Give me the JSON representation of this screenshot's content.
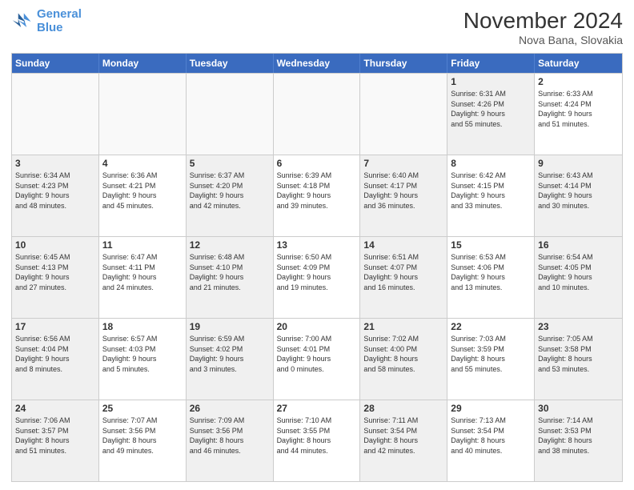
{
  "logo": {
    "line1": "General",
    "line2": "Blue"
  },
  "title": "November 2024",
  "location": "Nova Bana, Slovakia",
  "headers": [
    "Sunday",
    "Monday",
    "Tuesday",
    "Wednesday",
    "Thursday",
    "Friday",
    "Saturday"
  ],
  "weeks": [
    [
      {
        "day": "",
        "info": "",
        "shaded": false,
        "empty": true
      },
      {
        "day": "",
        "info": "",
        "shaded": false,
        "empty": true
      },
      {
        "day": "",
        "info": "",
        "shaded": false,
        "empty": true
      },
      {
        "day": "",
        "info": "",
        "shaded": false,
        "empty": true
      },
      {
        "day": "",
        "info": "",
        "shaded": false,
        "empty": true
      },
      {
        "day": "1",
        "info": "Sunrise: 6:31 AM\nSunset: 4:26 PM\nDaylight: 9 hours\nand 55 minutes.",
        "shaded": true,
        "empty": false
      },
      {
        "day": "2",
        "info": "Sunrise: 6:33 AM\nSunset: 4:24 PM\nDaylight: 9 hours\nand 51 minutes.",
        "shaded": false,
        "empty": false
      }
    ],
    [
      {
        "day": "3",
        "info": "Sunrise: 6:34 AM\nSunset: 4:23 PM\nDaylight: 9 hours\nand 48 minutes.",
        "shaded": true,
        "empty": false
      },
      {
        "day": "4",
        "info": "Sunrise: 6:36 AM\nSunset: 4:21 PM\nDaylight: 9 hours\nand 45 minutes.",
        "shaded": false,
        "empty": false
      },
      {
        "day": "5",
        "info": "Sunrise: 6:37 AM\nSunset: 4:20 PM\nDaylight: 9 hours\nand 42 minutes.",
        "shaded": true,
        "empty": false
      },
      {
        "day": "6",
        "info": "Sunrise: 6:39 AM\nSunset: 4:18 PM\nDaylight: 9 hours\nand 39 minutes.",
        "shaded": false,
        "empty": false
      },
      {
        "day": "7",
        "info": "Sunrise: 6:40 AM\nSunset: 4:17 PM\nDaylight: 9 hours\nand 36 minutes.",
        "shaded": true,
        "empty": false
      },
      {
        "day": "8",
        "info": "Sunrise: 6:42 AM\nSunset: 4:15 PM\nDaylight: 9 hours\nand 33 minutes.",
        "shaded": false,
        "empty": false
      },
      {
        "day": "9",
        "info": "Sunrise: 6:43 AM\nSunset: 4:14 PM\nDaylight: 9 hours\nand 30 minutes.",
        "shaded": true,
        "empty": false
      }
    ],
    [
      {
        "day": "10",
        "info": "Sunrise: 6:45 AM\nSunset: 4:13 PM\nDaylight: 9 hours\nand 27 minutes.",
        "shaded": true,
        "empty": false
      },
      {
        "day": "11",
        "info": "Sunrise: 6:47 AM\nSunset: 4:11 PM\nDaylight: 9 hours\nand 24 minutes.",
        "shaded": false,
        "empty": false
      },
      {
        "day": "12",
        "info": "Sunrise: 6:48 AM\nSunset: 4:10 PM\nDaylight: 9 hours\nand 21 minutes.",
        "shaded": true,
        "empty": false
      },
      {
        "day": "13",
        "info": "Sunrise: 6:50 AM\nSunset: 4:09 PM\nDaylight: 9 hours\nand 19 minutes.",
        "shaded": false,
        "empty": false
      },
      {
        "day": "14",
        "info": "Sunrise: 6:51 AM\nSunset: 4:07 PM\nDaylight: 9 hours\nand 16 minutes.",
        "shaded": true,
        "empty": false
      },
      {
        "day": "15",
        "info": "Sunrise: 6:53 AM\nSunset: 4:06 PM\nDaylight: 9 hours\nand 13 minutes.",
        "shaded": false,
        "empty": false
      },
      {
        "day": "16",
        "info": "Sunrise: 6:54 AM\nSunset: 4:05 PM\nDaylight: 9 hours\nand 10 minutes.",
        "shaded": true,
        "empty": false
      }
    ],
    [
      {
        "day": "17",
        "info": "Sunrise: 6:56 AM\nSunset: 4:04 PM\nDaylight: 9 hours\nand 8 minutes.",
        "shaded": true,
        "empty": false
      },
      {
        "day": "18",
        "info": "Sunrise: 6:57 AM\nSunset: 4:03 PM\nDaylight: 9 hours\nand 5 minutes.",
        "shaded": false,
        "empty": false
      },
      {
        "day": "19",
        "info": "Sunrise: 6:59 AM\nSunset: 4:02 PM\nDaylight: 9 hours\nand 3 minutes.",
        "shaded": true,
        "empty": false
      },
      {
        "day": "20",
        "info": "Sunrise: 7:00 AM\nSunset: 4:01 PM\nDaylight: 9 hours\nand 0 minutes.",
        "shaded": false,
        "empty": false
      },
      {
        "day": "21",
        "info": "Sunrise: 7:02 AM\nSunset: 4:00 PM\nDaylight: 8 hours\nand 58 minutes.",
        "shaded": true,
        "empty": false
      },
      {
        "day": "22",
        "info": "Sunrise: 7:03 AM\nSunset: 3:59 PM\nDaylight: 8 hours\nand 55 minutes.",
        "shaded": false,
        "empty": false
      },
      {
        "day": "23",
        "info": "Sunrise: 7:05 AM\nSunset: 3:58 PM\nDaylight: 8 hours\nand 53 minutes.",
        "shaded": true,
        "empty": false
      }
    ],
    [
      {
        "day": "24",
        "info": "Sunrise: 7:06 AM\nSunset: 3:57 PM\nDaylight: 8 hours\nand 51 minutes.",
        "shaded": true,
        "empty": false
      },
      {
        "day": "25",
        "info": "Sunrise: 7:07 AM\nSunset: 3:56 PM\nDaylight: 8 hours\nand 49 minutes.",
        "shaded": false,
        "empty": false
      },
      {
        "day": "26",
        "info": "Sunrise: 7:09 AM\nSunset: 3:56 PM\nDaylight: 8 hours\nand 46 minutes.",
        "shaded": true,
        "empty": false
      },
      {
        "day": "27",
        "info": "Sunrise: 7:10 AM\nSunset: 3:55 PM\nDaylight: 8 hours\nand 44 minutes.",
        "shaded": false,
        "empty": false
      },
      {
        "day": "28",
        "info": "Sunrise: 7:11 AM\nSunset: 3:54 PM\nDaylight: 8 hours\nand 42 minutes.",
        "shaded": true,
        "empty": false
      },
      {
        "day": "29",
        "info": "Sunrise: 7:13 AM\nSunset: 3:54 PM\nDaylight: 8 hours\nand 40 minutes.",
        "shaded": false,
        "empty": false
      },
      {
        "day": "30",
        "info": "Sunrise: 7:14 AM\nSunset: 3:53 PM\nDaylight: 8 hours\nand 38 minutes.",
        "shaded": true,
        "empty": false
      }
    ]
  ]
}
